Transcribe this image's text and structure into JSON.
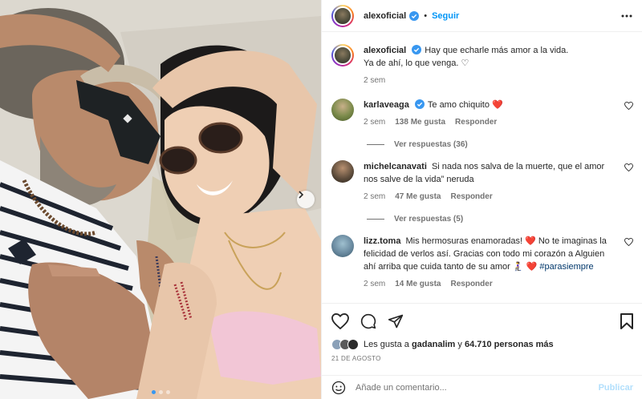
{
  "post": {
    "image_alt": "Selfie de pareja con gafas de sol recostados al aire libre",
    "carousel_dots": 3,
    "carousel_active": 0
  },
  "header": {
    "username": "alexoficial",
    "separator": "•",
    "follow_label": "Seguir"
  },
  "caption": {
    "username": "alexoficial",
    "text_line1": "Hay que echarle más amor a la vida.",
    "text_line2": "Ya de ahí, lo que venga. ♡",
    "time": "2 sem"
  },
  "comments": [
    {
      "username": "karlaveaga",
      "verified": true,
      "text": "Te amo chiquito ❤️",
      "time": "2 sem",
      "likes": "138 Me gusta",
      "reply_label": "Responder",
      "view_replies": "Ver respuestas (36)",
      "avatar_color": "#7a8a4a"
    },
    {
      "username": "michelcanavati",
      "verified": false,
      "text": "Si nada nos salva de la muerte, que el amor nos salve de la vida” neruda",
      "time": "2 sem",
      "likes": "47 Me gusta",
      "reply_label": "Responder",
      "view_replies": "Ver respuestas (5)",
      "avatar_color": "#5a4a3a"
    },
    {
      "username": "lizz.toma",
      "verified": false,
      "text": "Mis hermosuras enamoradas! ❤️  No te imaginas la felicidad de verlos así. Gracias con todo mi corazón a Alguien ahí arriba que cuida tanto de su amor 🧎‍♀️ ❤️",
      "hashtag": "#parasiempre",
      "time": "2 sem",
      "likes": "14 Me gusta",
      "reply_label": "Responder",
      "avatar_color": "#6a8aa0"
    }
  ],
  "likes": {
    "prefix": "Les gusta a",
    "user": "gadanalim",
    "middle": "y",
    "count": "64.710 personas más"
  },
  "date": "21 DE AGOSTO",
  "add_comment": {
    "placeholder": "Añade un comentario...",
    "publish_label": "Publicar"
  },
  "colors": {
    "accent": "#0095f6",
    "heart": "#ed4956",
    "verified": "#3897f0"
  }
}
